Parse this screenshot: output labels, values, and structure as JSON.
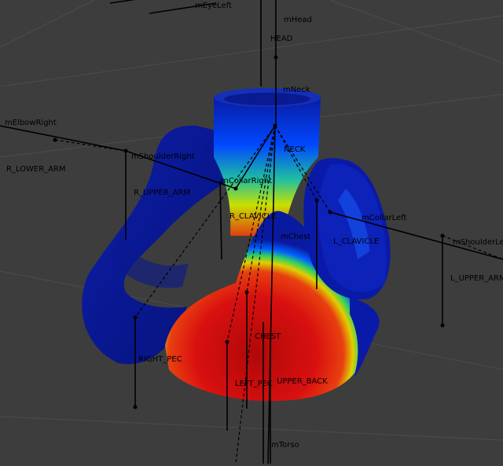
{
  "viewport": {
    "background": "#3d3d3d",
    "grid_color": "#4a4a4a",
    "bone_color": "#000000",
    "weight_colors": {
      "zero": "#0a1a9a",
      "low": "#0040ff",
      "mid": "#00e060",
      "high": "#e0e000",
      "full": "#d01010"
    }
  },
  "labels": {
    "mEyeLeft": "mEyeLeft",
    "mHead": "mHead",
    "HEAD": "HEAD",
    "mNeck": "mNeck",
    "mElbowRight": "mElbowRight",
    "mShoulderRight": "mShoulderRight",
    "R_LOWER_ARM": "R_LOWER_ARM",
    "R_UPPER_ARM": "R_UPPER_ARM",
    "mCollarRight": "mCollarRight",
    "NECK": "NECK",
    "R_CLAVICLE": "R_CLAVICLE",
    "mCollarLeft": "mCollarLeft",
    "mChest": "mChest",
    "L_CLAVICLE": "L_CLAVICLE",
    "mShoulderLeft": "mShoulderLe",
    "L_UPPER_ARM": "L_UPPER_ARM",
    "CHEST": "CHEST",
    "RIGHT_PEC": "RIGHT_PEC",
    "LEFT_PEC": "LEFT_PEC",
    "UPPER_BACK": "UPPER_BACK",
    "mTorso": "mTorso"
  }
}
